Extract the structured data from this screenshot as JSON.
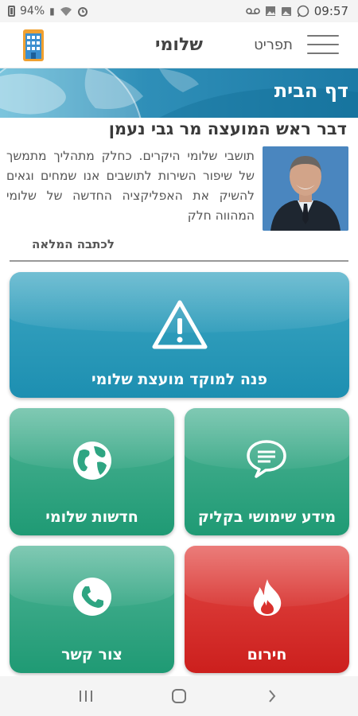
{
  "status_bar": {
    "battery": "94%",
    "time": "09:57",
    "icons": [
      "battery-icon",
      "vibrate-icon",
      "wifi-icon",
      "alarm-icon",
      "voicemail-icon",
      "image-icon",
      "gallery-icon",
      "whatsapp-icon"
    ]
  },
  "app_bar": {
    "title": "שלומי",
    "menu_label": "תפריט",
    "logo_icon": "building-logo-icon",
    "menu_icon": "hamburger-icon"
  },
  "banner": {
    "title": "דף הבית"
  },
  "speech": {
    "heading": "דבר ראש המועצה מר גבי נעמן",
    "text": "תושבי שלומי היקרים. כחלק מתהליך מתמשך של שיפור השירות לתושבים אנו שמחים וגאים להשיק את האפליקציה החדשה של שלומי המהווה חלק",
    "read_more": "לכתבה המלאה"
  },
  "tiles": {
    "main": {
      "label": "פנה למוקד מועצת שלומי",
      "icon": "warning-icon"
    },
    "info": {
      "label": "מידע שימושי בקליק",
      "icon": "chat-bubble-icon"
    },
    "news": {
      "label": "חדשות שלומי",
      "icon": "globe-icon"
    },
    "emergency": {
      "label": "חירום",
      "icon": "fire-icon"
    },
    "contact": {
      "label": "צור קשר",
      "icon": "phone-icon"
    }
  },
  "colors": {
    "main_tile": "#2a9bbb",
    "green_tile": "#2ea582",
    "red_tile": "#d9302c",
    "banner": "#2f8fb8"
  },
  "nav_bar": {
    "icons": [
      "recent-apps-icon",
      "home-icon",
      "back-icon"
    ]
  }
}
